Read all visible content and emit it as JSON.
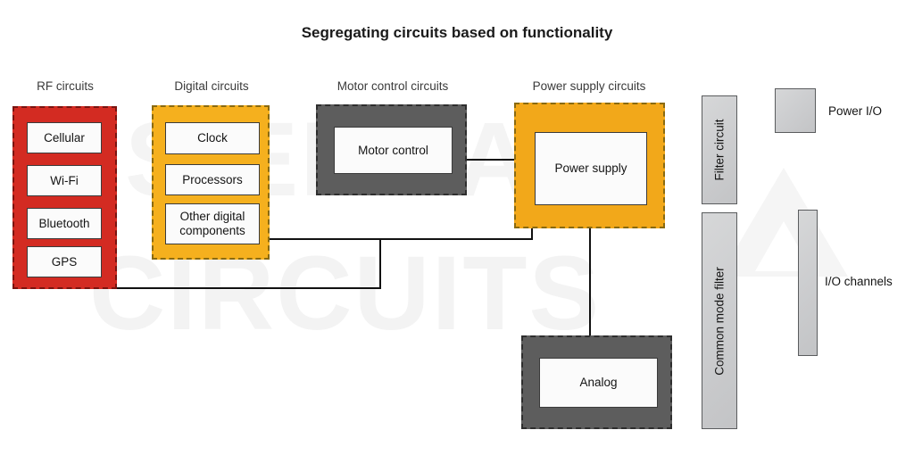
{
  "title": "Segregating circuits based on functionality",
  "watermark": {
    "line1": "SIERRA",
    "line2": "CIRCUITS"
  },
  "groups": [
    {
      "id": "rf",
      "header": "RF circuits",
      "color": "#D32B22",
      "items": [
        "Cellular",
        "Wi-Fi",
        "Bluetooth",
        "GPS"
      ]
    },
    {
      "id": "digital",
      "header": "Digital circuits",
      "color": "#F5B01E",
      "items": [
        "Clock",
        "Processors",
        "Other digital components"
      ]
    },
    {
      "id": "motor",
      "header": "Motor control circuits",
      "color": "#5D5D5D",
      "items": [
        "Motor control"
      ]
    },
    {
      "id": "power",
      "header": "Power supply circuits",
      "color": "#F2A81A",
      "items": [
        "Power supply"
      ]
    },
    {
      "id": "analog",
      "header": "",
      "color": "#5D5D5D",
      "items": [
        "Analog"
      ]
    }
  ],
  "filters": [
    {
      "id": "filter-circuit",
      "label": "Filter circuit"
    },
    {
      "id": "common-mode-filter",
      "label": "Common mode filter"
    }
  ],
  "legend": [
    {
      "id": "power-io",
      "label": "Power I/O",
      "swatch": "#CDCED0"
    },
    {
      "id": "io-channels",
      "label": "I/O channels",
      "swatch": "#CDCED0"
    }
  ]
}
